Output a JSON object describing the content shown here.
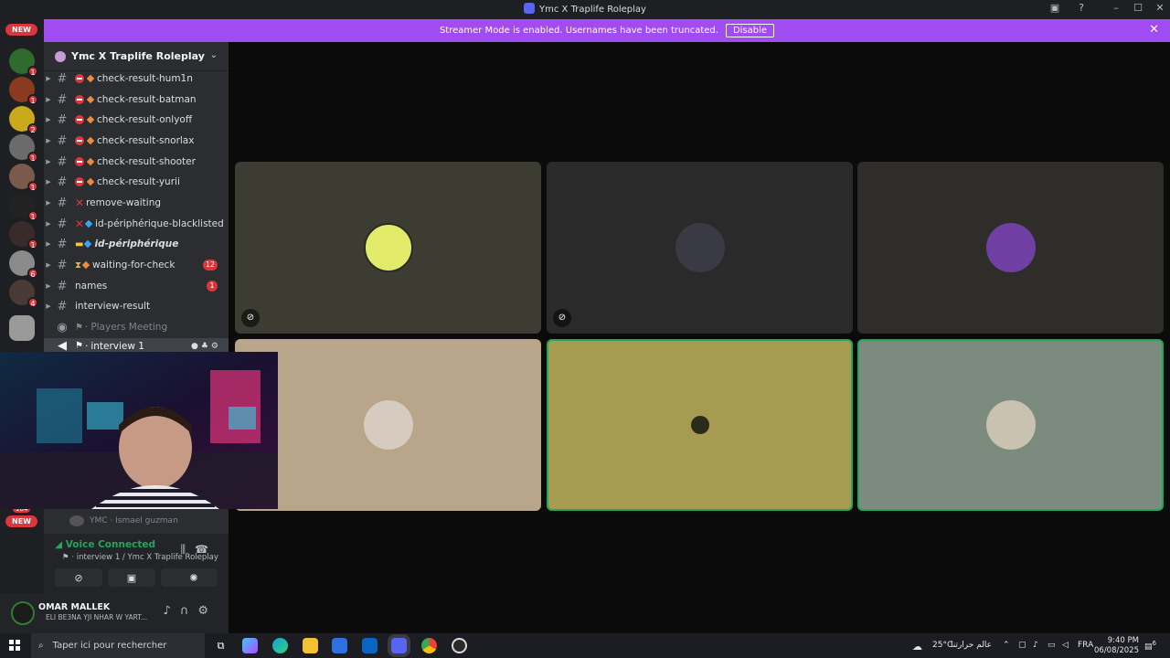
{
  "window": {
    "title": "Ymc X Traplife Roleplay",
    "controls": {
      "minimize": "–",
      "maximize": "☐",
      "close": "✕"
    }
  },
  "banner": {
    "text": "Streamer Mode is enabled. Usernames have been truncated.",
    "button": "Disable",
    "close": "✕"
  },
  "server_rail": {
    "new_top": "NEW",
    "new_bottom": "NEW",
    "count_184": "184",
    "servers": [
      {
        "badge": "1"
      },
      {
        "badge": "1"
      },
      {
        "badge": "2"
      },
      {
        "badge": "1"
      },
      {
        "badge": "1"
      },
      {
        "badge": "1"
      },
      {
        "badge": "1"
      },
      {
        "badge": "6"
      },
      {
        "badge": "4"
      }
    ]
  },
  "sidebar": {
    "guild_name": "Ymc X Traplife Roleplay",
    "channels": [
      {
        "name": "check-result-hum1n"
      },
      {
        "name": "check-result-batman"
      },
      {
        "name": "check-result-onlyoff"
      },
      {
        "name": "check-result-snorlax"
      },
      {
        "name": "check-result-shooter"
      },
      {
        "name": "check-result-yurii"
      },
      {
        "name": "remove-waiting"
      },
      {
        "name": "id-périphérique-blacklisted"
      },
      {
        "name": "id-périphérique"
      },
      {
        "name": "waiting-for-check",
        "badge": "12"
      },
      {
        "name": "names",
        "badge": "1"
      },
      {
        "name": "interview-result"
      }
    ],
    "voice": [
      {
        "name": "Players Meeting"
      },
      {
        "name": "interview 1"
      }
    ],
    "voice_member": "YMC · Ismael guzman"
  },
  "voice_panel": {
    "status": "Voice Connected",
    "location": "interview 1 / Ymc X Traplife Roleplay"
  },
  "user": {
    "name": "OMAR MALLEK",
    "status": "ELI BE3NA YJI NHAR W YART..."
  },
  "taskbar": {
    "search_placeholder": "Taper ici pour rechercher",
    "temperature": "25°C",
    "weather": "عالم حرارتنا",
    "language": "FRA",
    "time": "9:40 PM",
    "date": "06/08/2025",
    "notifications": "6"
  },
  "colors": {
    "accent": "#a14cf0",
    "speaking": "#23a55a",
    "badge": "#da373c",
    "tile1": "#3c3c32",
    "tile2": "#2a2a2a",
    "tile3": "#2e2d29",
    "tile4": "#b9a58a",
    "tile5": "#a79a51",
    "tile6": "#7b8c7f"
  }
}
